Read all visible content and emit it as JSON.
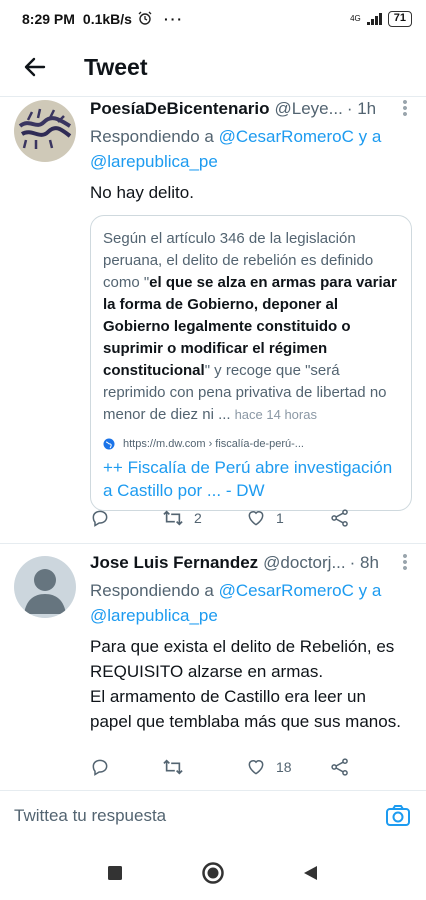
{
  "status_bar": {
    "time": "8:29 PM",
    "speed": "0.1kB/s",
    "network": "4G",
    "battery": "71"
  },
  "header": {
    "title": "Tweet"
  },
  "tweets": [
    {
      "name": "PoesíaDeBicentenario",
      "handle": "@Leye...",
      "time": "· 1h",
      "replying_prefix": "Respondiendo a",
      "reply_mentions": "@CesarRomeroC y a",
      "reply_mentions_2": "@larepublica_pe",
      "text": "No hay delito.",
      "card": {
        "quote_1": "Según el artículo 346 de la legislación peruana, el delito de rebelión es definido como \"",
        "quote_bold_1": "el que se alza en armas para variar la forma de Gobierno, deponer al Gobierno legalmente constituido o suprimir o modificar el régimen constitucional",
        "quote_2": "\" y recoge que \"será reprimido con pena privativa de libertad no menor de diez ni ...",
        "when": "hace 14 horas",
        "site": "https://m.dw.com › fiscalía-de-perú-...",
        "title": "++ Fiscalía de Perú abre investigación a Castillo por ... - DW"
      },
      "actions": {
        "reply": "",
        "retweets": "2",
        "likes": "1"
      }
    },
    {
      "name": "Jose Luis Fernandez",
      "handle": "@doctorj...",
      "time": "· 8h",
      "replying_prefix": "Respondiendo a",
      "reply_mentions": "@CesarRomeroC y a",
      "reply_mentions_2": "@larepublica_pe",
      "text_1": "Para que exista el delito de Rebelión, es REQUISITO alzarse en armas.",
      "text_2": "El armamento de Castillo era leer un papel que temblaba más que sus manos.",
      "actions": {
        "reply": "",
        "retweets": "",
        "likes": "18"
      }
    }
  ],
  "reply_bar": {
    "placeholder": "Twittea tu respuesta"
  },
  "colors": {
    "accent": "#1d9bf0",
    "muted": "#536471",
    "divider": "#e6ecf0"
  },
  "icons": [
    "back-arrow-icon",
    "more-icon",
    "reply-icon",
    "retweet-icon",
    "like-icon",
    "share-icon",
    "globe-icon",
    "camera-icon",
    "recents-icon",
    "home-icon",
    "back-nav-icon"
  ]
}
